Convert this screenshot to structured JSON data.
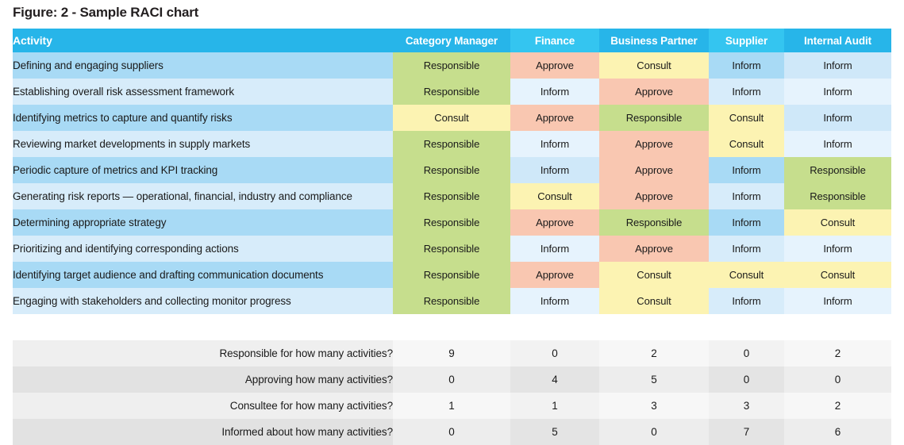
{
  "figure": {
    "title": "Figure: 2 - Sample RACI chart"
  },
  "colors": {
    "header_primary": "#27b5e9",
    "header_alt": "#34c5f0",
    "responsible": "#c6de8d",
    "approve": "#f9c7b1",
    "consult": "#fcf3b2",
    "inform_dark": "#a8daf5",
    "inform_light": "#d7ecfa",
    "activity_odd": "#a8daf5",
    "activity_even": "#d7ecfa"
  },
  "table": {
    "columns": [
      {
        "key": "activity",
        "label": "Activity"
      },
      {
        "key": "category_manager",
        "label": "Category Manager"
      },
      {
        "key": "finance",
        "label": "Finance"
      },
      {
        "key": "business_partner",
        "label": "Business Partner"
      },
      {
        "key": "supplier",
        "label": "Supplier"
      },
      {
        "key": "internal_audit",
        "label": "Internal Audit"
      }
    ],
    "rows": [
      {
        "activity": "Defining and engaging suppliers",
        "values": [
          "Responsible",
          "Approve",
          "Consult",
          "Inform",
          "Inform"
        ]
      },
      {
        "activity": "Establishing overall risk assessment framework",
        "values": [
          "Responsible",
          "Inform",
          "Approve",
          "Inform",
          "Inform"
        ]
      },
      {
        "activity": "Identifying metrics to capture and quantify risks",
        "values": [
          "Consult",
          "Approve",
          "Responsible",
          "Consult",
          "Inform"
        ]
      },
      {
        "activity": "Reviewing market developments in supply markets",
        "values": [
          "Responsible",
          "Inform",
          "Approve",
          "Consult",
          "Inform"
        ]
      },
      {
        "activity": "Periodic capture of metrics and KPI tracking",
        "values": [
          "Responsible",
          "Inform",
          "Approve",
          "Inform",
          "Responsible"
        ]
      },
      {
        "activity": "Generating risk reports — operational, financial, industry and compliance",
        "values": [
          "Responsible",
          "Consult",
          "Approve",
          "Inform",
          "Responsible"
        ]
      },
      {
        "activity": "Determining appropriate strategy",
        "values": [
          "Responsible",
          "Approve",
          "Responsible",
          "Inform",
          "Consult"
        ]
      },
      {
        "activity": "Prioritizing and identifying corresponding actions",
        "values": [
          "Responsible",
          "Inform",
          "Approve",
          "Inform",
          "Inform"
        ]
      },
      {
        "activity": "Identifying target audience and drafting communication documents",
        "values": [
          "Responsible",
          "Approve",
          "Consult",
          "Consult",
          "Consult"
        ]
      },
      {
        "activity": "Engaging with stakeholders and collecting monitor progress",
        "values": [
          "Responsible",
          "Inform",
          "Consult",
          "Inform",
          "Inform"
        ]
      }
    ],
    "summary": [
      {
        "label": "Responsible for how many activities?",
        "values": [
          "9",
          "0",
          "2",
          "0",
          "2"
        ]
      },
      {
        "label": "Approving how many activities?",
        "values": [
          "0",
          "4",
          "5",
          "0",
          "0"
        ]
      },
      {
        "label": "Consultee for how many activities?",
        "values": [
          "1",
          "1",
          "3",
          "3",
          "2"
        ]
      },
      {
        "label": "Informed about how many activities?",
        "values": [
          "0",
          "5",
          "0",
          "7",
          "6"
        ]
      }
    ]
  }
}
